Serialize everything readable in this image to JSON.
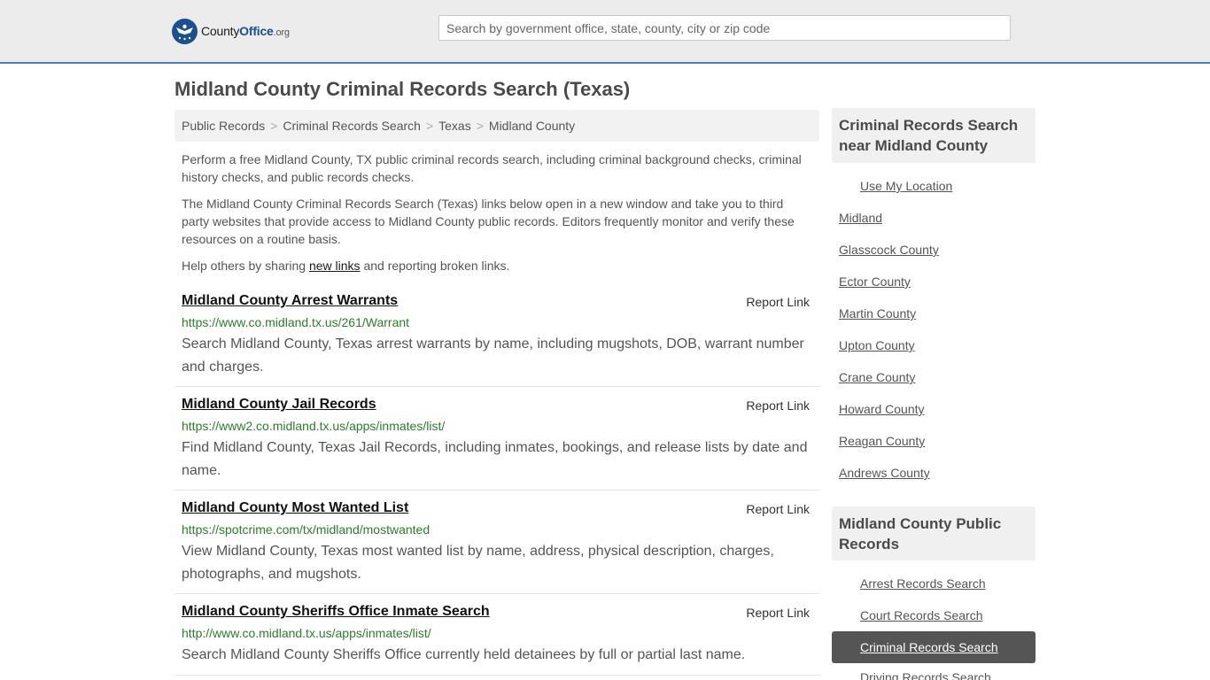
{
  "header": {
    "logo_main": "County",
    "logo_bold": "Office",
    "logo_suffix": ".org",
    "search_placeholder": "Search by government office, state, county, city or zip code"
  },
  "page": {
    "title": "Midland County Criminal Records Search (Texas)",
    "breadcrumb": [
      "Public Records",
      "Criminal Records Search",
      "Texas",
      "Midland County"
    ],
    "intro1": "Perform a free Midland County, TX public criminal records search, including criminal background checks, criminal history checks, and public records checks.",
    "intro2": "The Midland County Criminal Records Search (Texas) links below open in a new window and take you to third party websites that provide access to Midland County public records. Editors frequently monitor and verify these resources on a routine basis.",
    "intro3_pre": "Help others by sharing ",
    "intro3_link": "new links",
    "intro3_post": " and reporting broken links.",
    "report_label": "Report Link"
  },
  "results": [
    {
      "title": "Midland County Arrest Warrants",
      "url": "https://www.co.midland.tx.us/261/Warrant",
      "desc": "Search Midland County, Texas arrest warrants by name, including mugshots, DOB, warrant number and charges."
    },
    {
      "title": "Midland County Jail Records",
      "url": "https://www2.co.midland.tx.us/apps/inmates/list/",
      "desc": "Find Midland County, Texas Jail Records, including inmates, bookings, and release lists by date and name."
    },
    {
      "title": "Midland County Most Wanted List",
      "url": "https://spotcrime.com/tx/midland/mostwanted",
      "desc": "View Midland County, Texas most wanted list by name, address, physical description, charges, photographs, and mugshots."
    },
    {
      "title": "Midland County Sheriffs Office Inmate Search",
      "url": "http://www.co.midland.tx.us/apps/inmates/list/",
      "desc": "Search Midland County Sheriffs Office currently held detainees by full or partial last name."
    }
  ],
  "sidebar": {
    "nearby_title": "Criminal Records Search near Midland County",
    "use_location": "Use My Location",
    "nearby": [
      "Midland",
      "Glasscock County",
      "Ector County",
      "Martin County",
      "Upton County",
      "Crane County",
      "Howard County",
      "Reagan County",
      "Andrews County"
    ],
    "public_title": "Midland County Public Records",
    "public_links": [
      "Arrest Records Search",
      "Court Records Search",
      "Criminal Records Search",
      "Driving Records Search"
    ],
    "active_index": 2
  }
}
